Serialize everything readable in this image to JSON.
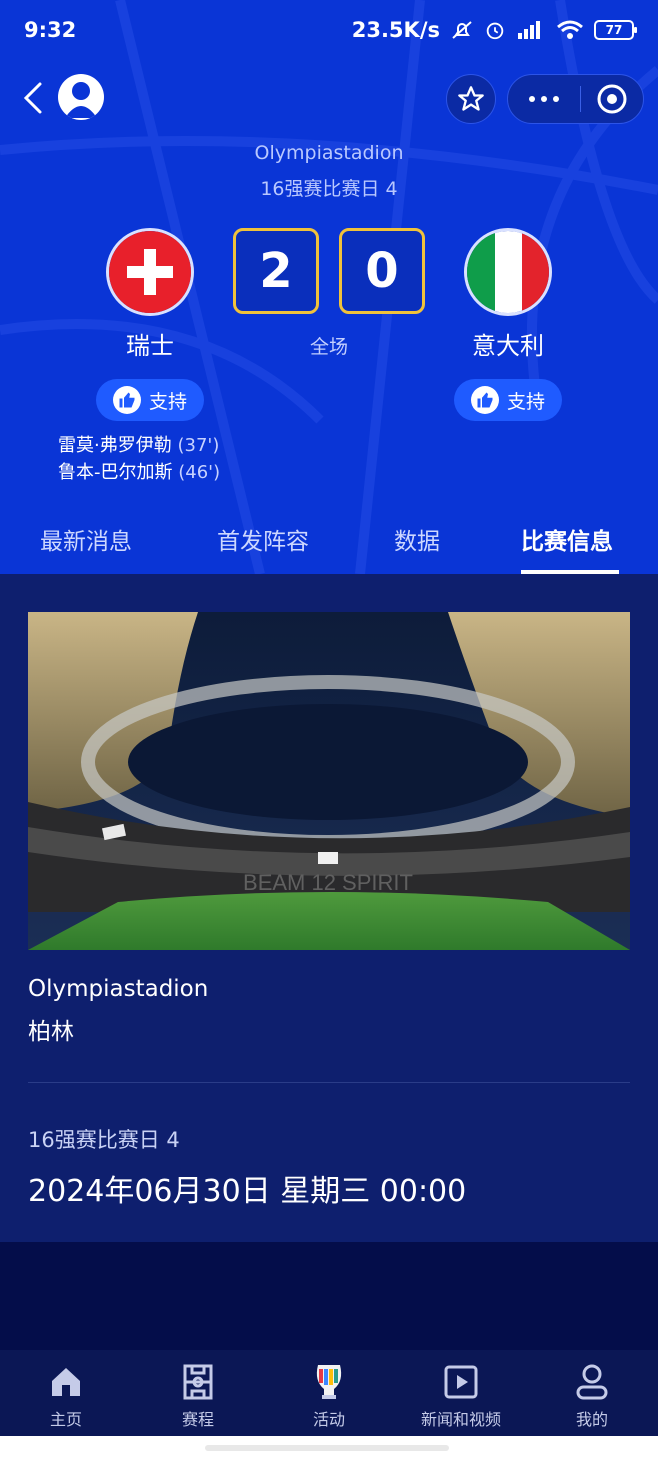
{
  "status_bar": {
    "time": "9:32",
    "net_speed": "23.5K/s",
    "battery": "77"
  },
  "header": {
    "venue": "Olympiastadion",
    "round": "16强赛比赛日 4"
  },
  "match": {
    "home": {
      "name": "瑞士",
      "score": "2",
      "support_label": "支持",
      "flag": "switzerland-flag"
    },
    "away": {
      "name": "意大利",
      "score": "0",
      "support_label": "支持",
      "flag": "italy-flag"
    },
    "status": "全场",
    "scorers": [
      {
        "name": "雷莫·弗罗伊勒",
        "minute": "(37')"
      },
      {
        "name": "鲁本-巴尔加斯",
        "minute": "(46')"
      }
    ]
  },
  "tabs": [
    {
      "label": "最新消息"
    },
    {
      "label": "首发阵容"
    },
    {
      "label": "数据"
    },
    {
      "label": "比赛信息",
      "active": true
    }
  ],
  "info": {
    "venue_name": "Olympiastadion",
    "city": "柏林",
    "round": "16强赛比赛日 4",
    "datetime": "2024年06月30日 星期三 00:00"
  },
  "bottom_nav": [
    {
      "label": "主页",
      "icon": "home-icon"
    },
    {
      "label": "赛程",
      "icon": "schedule-icon"
    },
    {
      "label": "活动",
      "icon": "euro-trophy-icon"
    },
    {
      "label": "新闻和视频",
      "icon": "video-icon"
    },
    {
      "label": "我的",
      "icon": "profile-icon"
    }
  ],
  "colors": {
    "hero_blue": "#0a35d6",
    "score_border": "#f0c23b",
    "content_bg": "#0e1f6e",
    "page_bg": "#040d4a"
  }
}
